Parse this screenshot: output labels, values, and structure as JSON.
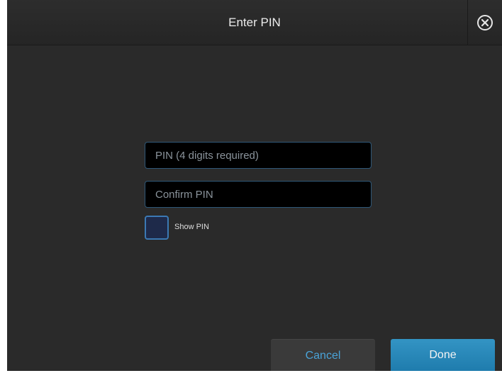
{
  "dialog": {
    "title": "Enter PIN",
    "close_icon": "close-circle-x-icon"
  },
  "form": {
    "pin_placeholder": "PIN (4 digits required)",
    "pin_value": "",
    "confirm_placeholder": "Confirm PIN",
    "confirm_value": "",
    "show_pin_label": "Show PIN",
    "show_pin_checked": false
  },
  "actions": {
    "cancel_label": "Cancel",
    "done_label": "Done"
  },
  "colors": {
    "background": "#2a2a2a",
    "field_border": "#2f5878",
    "checkbox_border": "#3b79b4",
    "accent_text": "#4aa3d8",
    "done_button": "#2588ba"
  }
}
